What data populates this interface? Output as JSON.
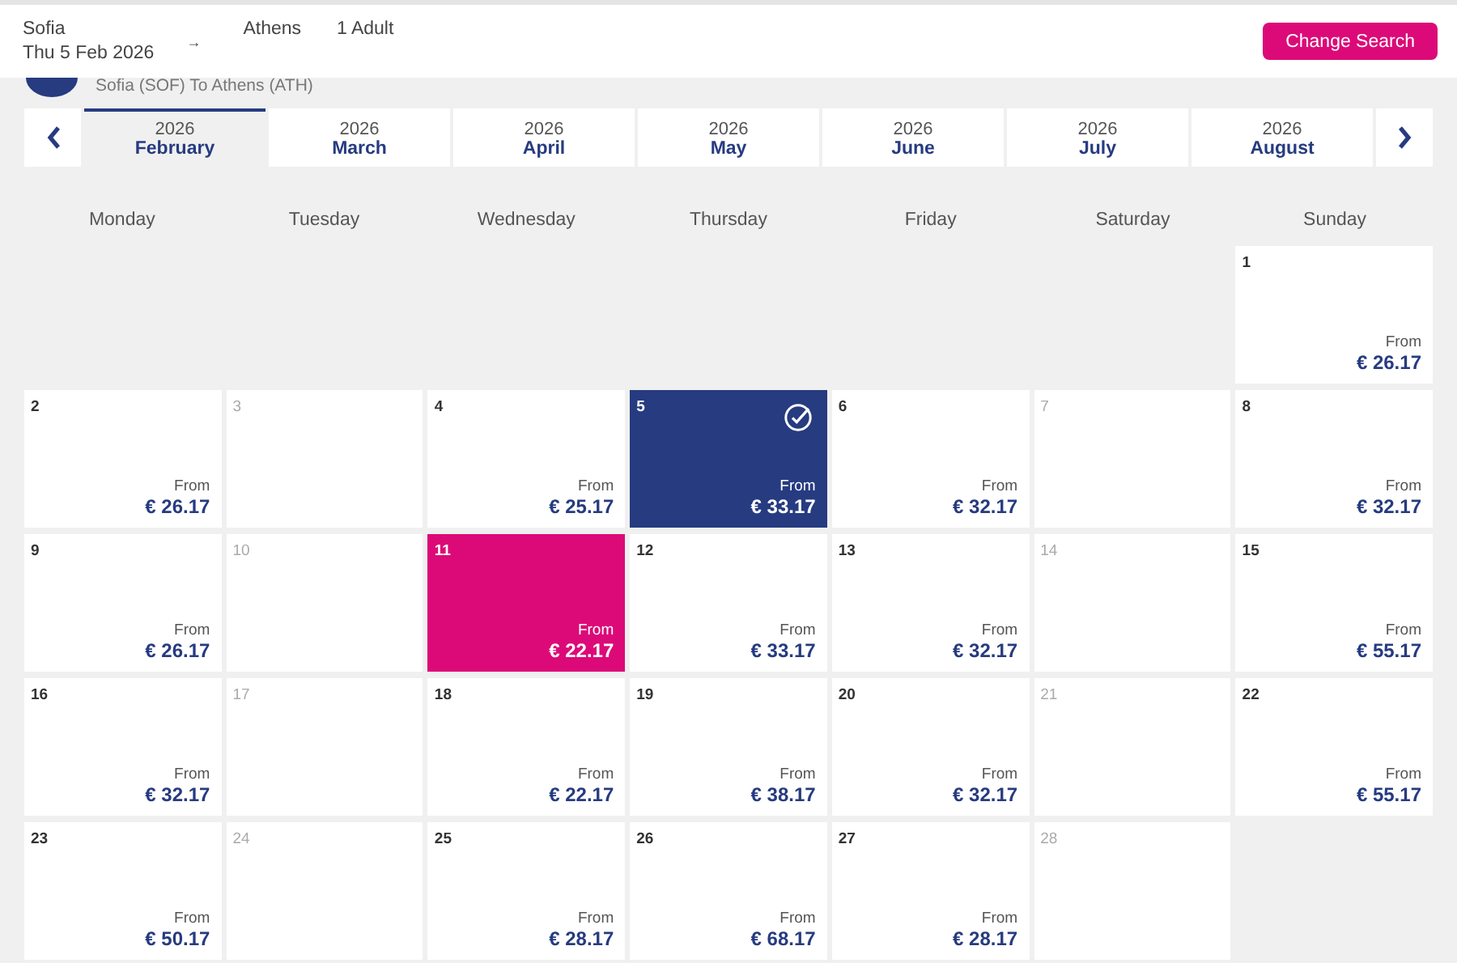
{
  "header": {
    "origin": "Sofia",
    "date": "Thu 5 Feb 2026",
    "arrow": "→",
    "destination": "Athens",
    "passengers": "1 Adult",
    "button": "Change Search"
  },
  "route": "Sofia (SOF) To Athens (ATH)",
  "months": [
    {
      "year": "2026",
      "name": "February",
      "selected": true
    },
    {
      "year": "2026",
      "name": "March",
      "selected": false
    },
    {
      "year": "2026",
      "name": "April",
      "selected": false
    },
    {
      "year": "2026",
      "name": "May",
      "selected": false
    },
    {
      "year": "2026",
      "name": "June",
      "selected": false
    },
    {
      "year": "2026",
      "name": "July",
      "selected": false
    },
    {
      "year": "2026",
      "name": "August",
      "selected": false
    }
  ],
  "weekdays": [
    "Monday",
    "Tuesday",
    "Wednesday",
    "Thursday",
    "Friday",
    "Saturday",
    "Sunday"
  ],
  "weeks": [
    [
      {
        "kind": "blank"
      },
      {
        "kind": "blank"
      },
      {
        "kind": "blank"
      },
      {
        "kind": "blank"
      },
      {
        "kind": "blank"
      },
      {
        "kind": "blank"
      },
      {
        "kind": "fare",
        "day": "1",
        "label": "From",
        "price": "€ 26.17",
        "selected": false,
        "lowest": false
      }
    ],
    [
      {
        "kind": "fare",
        "day": "2",
        "label": "From",
        "price": "€ 26.17",
        "selected": false,
        "lowest": false
      },
      {
        "kind": "unavailable",
        "day": "3"
      },
      {
        "kind": "fare",
        "day": "4",
        "label": "From",
        "price": "€ 25.17",
        "selected": false,
        "lowest": false
      },
      {
        "kind": "fare",
        "day": "5",
        "label": "From",
        "price": "€ 33.17",
        "selected": true,
        "lowest": false
      },
      {
        "kind": "fare",
        "day": "6",
        "label": "From",
        "price": "€ 32.17",
        "selected": false,
        "lowest": false
      },
      {
        "kind": "unavailable",
        "day": "7"
      },
      {
        "kind": "fare",
        "day": "8",
        "label": "From",
        "price": "€ 32.17",
        "selected": false,
        "lowest": false
      }
    ],
    [
      {
        "kind": "fare",
        "day": "9",
        "label": "From",
        "price": "€ 26.17",
        "selected": false,
        "lowest": false
      },
      {
        "kind": "unavailable",
        "day": "10"
      },
      {
        "kind": "fare",
        "day": "11",
        "label": "From",
        "price": "€ 22.17",
        "selected": false,
        "lowest": true
      },
      {
        "kind": "fare",
        "day": "12",
        "label": "From",
        "price": "€ 33.17",
        "selected": false,
        "lowest": false
      },
      {
        "kind": "fare",
        "day": "13",
        "label": "From",
        "price": "€ 32.17",
        "selected": false,
        "lowest": false
      },
      {
        "kind": "unavailable",
        "day": "14"
      },
      {
        "kind": "fare",
        "day": "15",
        "label": "From",
        "price": "€ 55.17",
        "selected": false,
        "lowest": false
      }
    ],
    [
      {
        "kind": "fare",
        "day": "16",
        "label": "From",
        "price": "€ 32.17",
        "selected": false,
        "lowest": false
      },
      {
        "kind": "unavailable",
        "day": "17"
      },
      {
        "kind": "fare",
        "day": "18",
        "label": "From",
        "price": "€ 22.17",
        "selected": false,
        "lowest": false
      },
      {
        "kind": "fare",
        "day": "19",
        "label": "From",
        "price": "€ 38.17",
        "selected": false,
        "lowest": false
      },
      {
        "kind": "fare",
        "day": "20",
        "label": "From",
        "price": "€ 32.17",
        "selected": false,
        "lowest": false
      },
      {
        "kind": "unavailable",
        "day": "21"
      },
      {
        "kind": "fare",
        "day": "22",
        "label": "From",
        "price": "€ 55.17",
        "selected": false,
        "lowest": false
      }
    ],
    [
      {
        "kind": "fare",
        "day": "23",
        "label": "From",
        "price": "€ 50.17",
        "selected": false,
        "lowest": false
      },
      {
        "kind": "unavailable",
        "day": "24"
      },
      {
        "kind": "fare",
        "day": "25",
        "label": "From",
        "price": "€ 28.17",
        "selected": false,
        "lowest": false
      },
      {
        "kind": "fare",
        "day": "26",
        "label": "From",
        "price": "€ 68.17",
        "selected": false,
        "lowest": false
      },
      {
        "kind": "fare",
        "day": "27",
        "label": "From",
        "price": "€ 28.17",
        "selected": false,
        "lowest": false
      },
      {
        "kind": "unavailable",
        "day": "28"
      },
      {
        "kind": "blank"
      }
    ]
  ]
}
